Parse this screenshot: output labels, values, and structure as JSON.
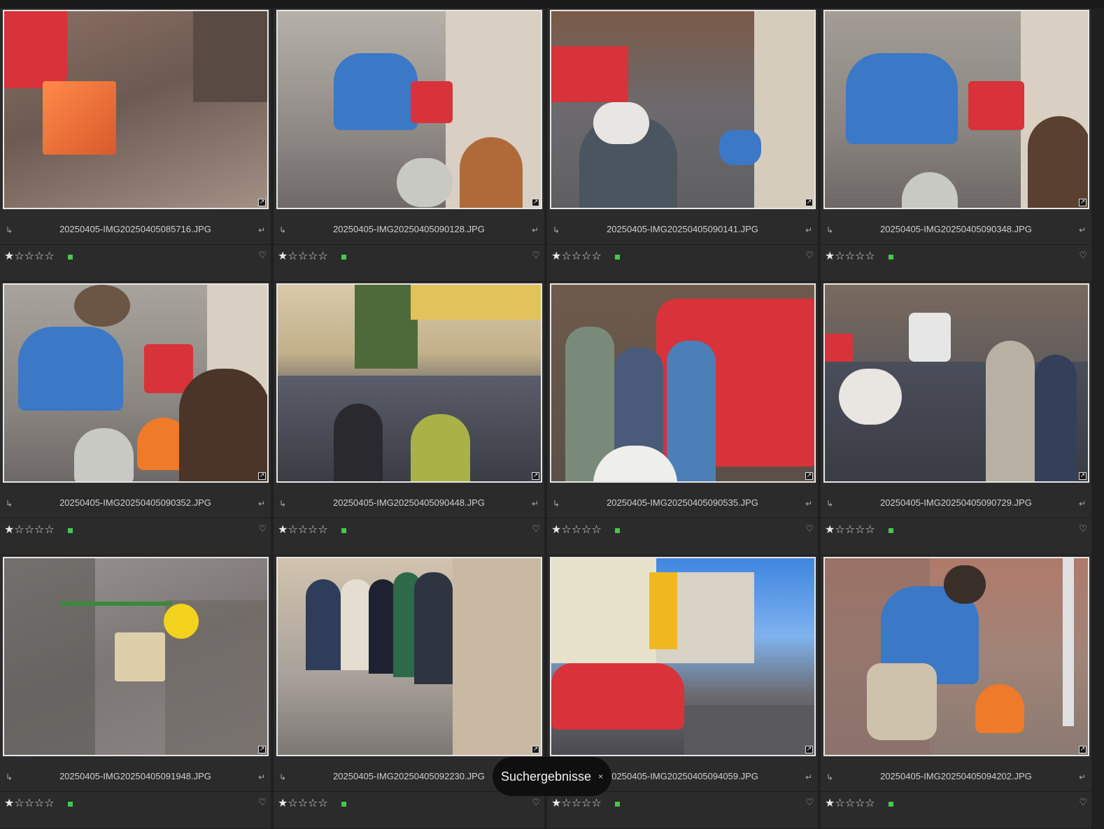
{
  "toast": {
    "label": "Suchergebnisse",
    "close": "×"
  },
  "icons": {
    "left": "↳",
    "right": "↵",
    "heart": "♡",
    "badge": "↗"
  },
  "colors": {
    "label_green": "#47c84a",
    "background": "#202020",
    "cell": "#2b2b2b"
  },
  "rating": {
    "value": 1,
    "max": 5
  },
  "thumbnails": [
    {
      "filename": "20250405-IMG20250405085716.JPG"
    },
    {
      "filename": "20250405-IMG20250405090128.JPG"
    },
    {
      "filename": "20250405-IMG20250405090141.JPG"
    },
    {
      "filename": "20250405-IMG20250405090348.JPG"
    },
    {
      "filename": "20250405-IMG20250405090352.JPG"
    },
    {
      "filename": "20250405-IMG20250405090448.JPG"
    },
    {
      "filename": "20250405-IMG20250405090535.JPG"
    },
    {
      "filename": "20250405-IMG20250405090729.JPG"
    },
    {
      "filename": "20250405-IMG20250405091948.JPG"
    },
    {
      "filename": "20250405-IMG20250405092230.JPG"
    },
    {
      "filename": "20250405-IMG20250405094059.JPG"
    },
    {
      "filename": "20250405-IMG20250405094202.JPG"
    }
  ]
}
